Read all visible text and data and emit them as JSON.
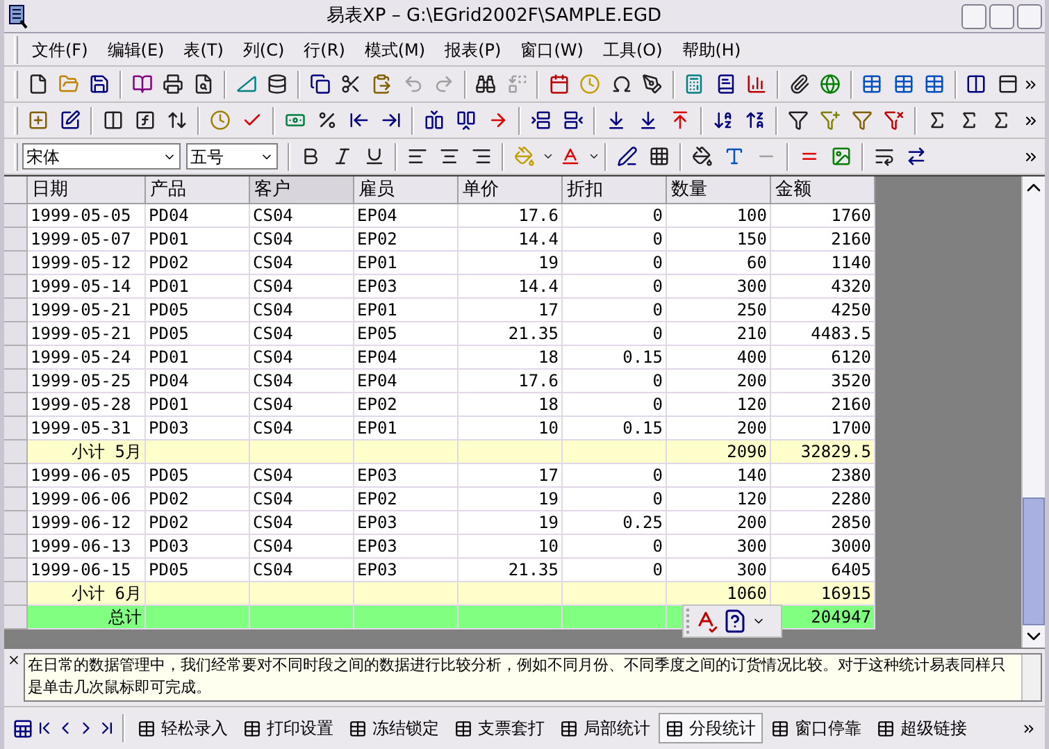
{
  "window": {
    "title": "易表XP  –  G:\\EGrid2002F\\SAMPLE.EGD"
  },
  "menu": [
    "文件(F)",
    "编辑(E)",
    "表(T)",
    "列(C)",
    "行(R)",
    "模式(M)",
    "报表(P)",
    "窗口(W)",
    "工具(O)",
    "帮助(H)"
  ],
  "format_bar": {
    "font": "宋体",
    "size": "五号"
  },
  "table": {
    "columns": [
      "日期",
      "产品",
      "客户",
      "雇员",
      "单价",
      "折扣",
      "数量",
      "金额"
    ],
    "rows": [
      {
        "kind": "data",
        "cells": [
          "1999-05-05",
          "PD04",
          "CS04",
          "EP04",
          "17.6",
          "0",
          "100",
          "1760"
        ]
      },
      {
        "kind": "data",
        "cells": [
          "1999-05-07",
          "PD01",
          "CS04",
          "EP02",
          "14.4",
          "0",
          "150",
          "2160"
        ]
      },
      {
        "kind": "data",
        "cells": [
          "1999-05-12",
          "PD02",
          "CS04",
          "EP01",
          "19",
          "0",
          "60",
          "1140"
        ]
      },
      {
        "kind": "data",
        "cells": [
          "1999-05-14",
          "PD01",
          "CS04",
          "EP03",
          "14.4",
          "0",
          "300",
          "4320"
        ]
      },
      {
        "kind": "data",
        "cells": [
          "1999-05-21",
          "PD05",
          "CS04",
          "EP01",
          "17",
          "0",
          "250",
          "4250"
        ]
      },
      {
        "kind": "data",
        "cells": [
          "1999-05-21",
          "PD05",
          "CS04",
          "EP05",
          "21.35",
          "0",
          "210",
          "4483.5"
        ]
      },
      {
        "kind": "data",
        "cells": [
          "1999-05-24",
          "PD01",
          "CS04",
          "EP04",
          "18",
          "0.15",
          "400",
          "6120"
        ]
      },
      {
        "kind": "data",
        "cells": [
          "1999-05-25",
          "PD04",
          "CS04",
          "EP04",
          "17.6",
          "0",
          "200",
          "3520"
        ]
      },
      {
        "kind": "data",
        "cells": [
          "1999-05-28",
          "PD01",
          "CS04",
          "EP02",
          "18",
          "0",
          "120",
          "2160"
        ]
      },
      {
        "kind": "data",
        "cells": [
          "1999-05-31",
          "PD03",
          "CS04",
          "EP01",
          "10",
          "0.15",
          "200",
          "1700"
        ]
      },
      {
        "kind": "subtotal",
        "label": "小计 5月",
        "quantity": "2090",
        "amount": "32829.5"
      },
      {
        "kind": "data",
        "cells": [
          "1999-06-05",
          "PD05",
          "CS04",
          "EP03",
          "17",
          "0",
          "140",
          "2380"
        ]
      },
      {
        "kind": "data",
        "cells": [
          "1999-06-06",
          "PD02",
          "CS04",
          "EP02",
          "19",
          "0",
          "120",
          "2280"
        ]
      },
      {
        "kind": "data",
        "cells": [
          "1999-06-12",
          "PD02",
          "CS04",
          "EP03",
          "19",
          "0.25",
          "200",
          "2850"
        ]
      },
      {
        "kind": "data",
        "cells": [
          "1999-06-13",
          "PD03",
          "CS04",
          "EP03",
          "10",
          "0",
          "300",
          "3000"
        ]
      },
      {
        "kind": "data",
        "cells": [
          "1999-06-15",
          "PD05",
          "CS04",
          "EP03",
          "21.35",
          "0",
          "300",
          "6405"
        ]
      },
      {
        "kind": "subtotal",
        "label": "小计 6月",
        "quantity": "1060",
        "amount": "16915"
      },
      {
        "kind": "total",
        "label": "总计",
        "amount": "204947"
      }
    ]
  },
  "note": "在日常的数据管理中，我们经常要对不同时段之间的数据进行比较分析，例如不同月份、不同季度之间的订货情况比较。对于这种统计易表同样只是单击几次鼠标即可完成。",
  "tabs": [
    {
      "label": "轻松录入",
      "selected": false
    },
    {
      "label": "打印设置",
      "selected": false
    },
    {
      "label": "冻结锁定",
      "selected": false
    },
    {
      "label": "支票套打",
      "selected": false
    },
    {
      "label": "局部统计",
      "selected": false
    },
    {
      "label": "分段统计",
      "selected": true
    },
    {
      "label": "窗口停靠",
      "selected": false
    },
    {
      "label": "超级链接",
      "selected": false
    }
  ]
}
